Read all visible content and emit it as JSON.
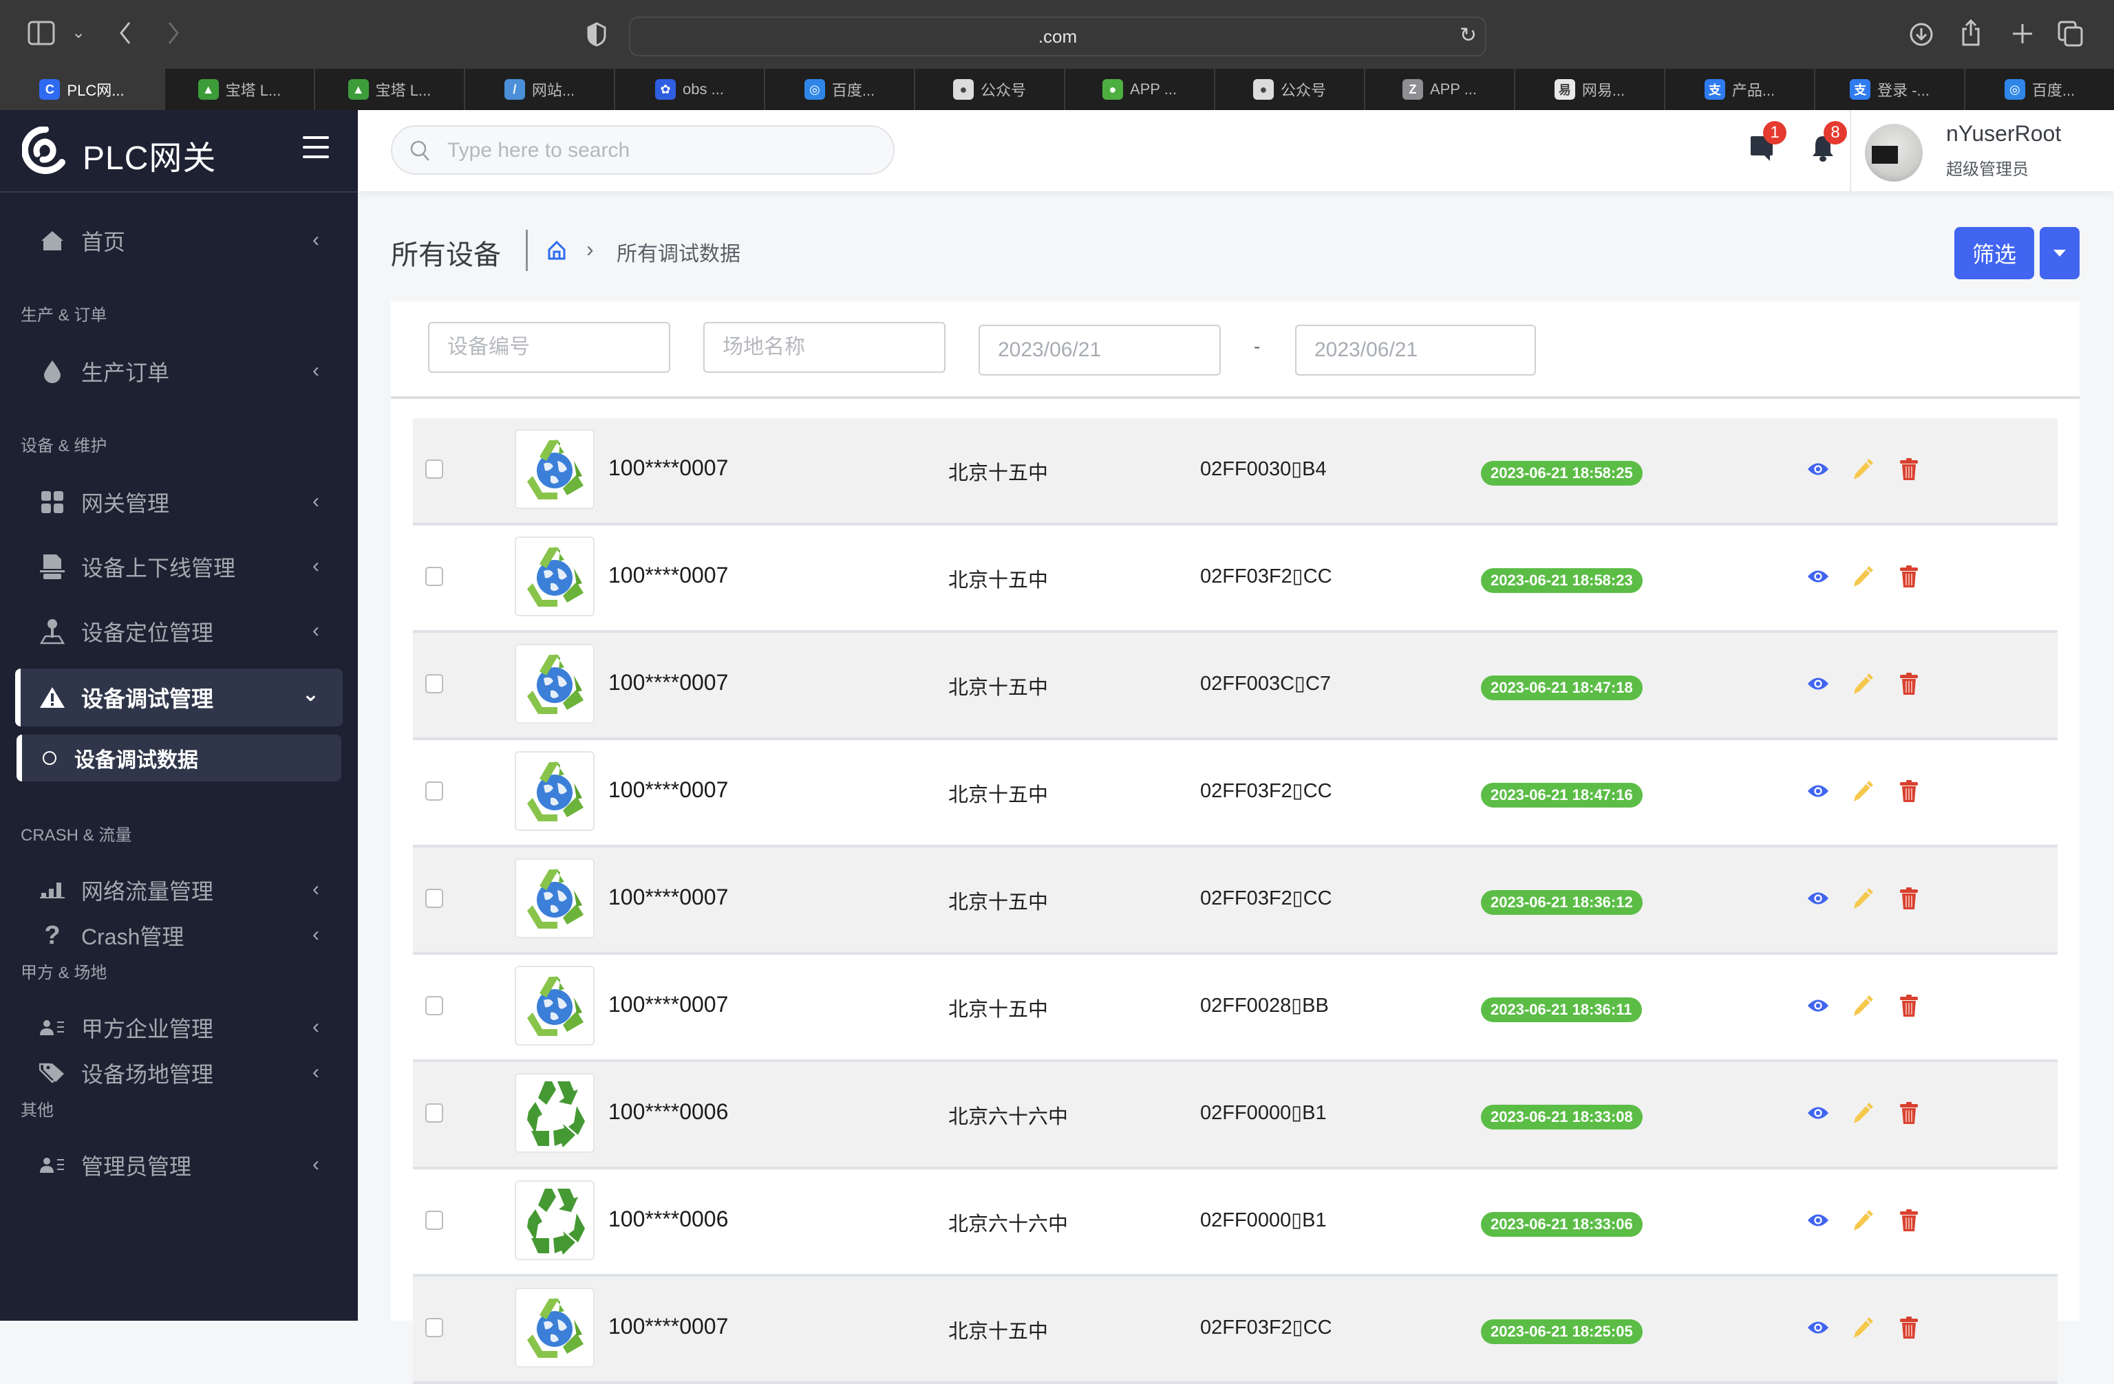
{
  "browser": {
    "url": ".com",
    "tabs": [
      {
        "label": "PLC网...",
        "icon": "plc-favicon",
        "color": "#2f6bf2",
        "glyph": "C"
      },
      {
        "label": "宝塔 L...",
        "icon": "baota-favicon",
        "color": "#3d9c3a",
        "glyph": "▲"
      },
      {
        "label": "宝塔 L...",
        "icon": "baota-favicon",
        "color": "#3d9c3a",
        "glyph": "▲"
      },
      {
        "label": "网站...",
        "icon": "website-favicon",
        "color": "#4a8fd8",
        "glyph": "/"
      },
      {
        "label": "obs ...",
        "icon": "baidu-paw-favicon",
        "color": "#2f5fe0",
        "glyph": "✿"
      },
      {
        "label": "百度...",
        "icon": "baidu-cloud-favicon",
        "color": "#2f86e8",
        "glyph": "◎"
      },
      {
        "label": "公众号",
        "icon": "wechat-official-favicon",
        "color": "#dcdcdc",
        "glyph": "●"
      },
      {
        "label": "APP ...",
        "icon": "wechat-favicon",
        "color": "#4caf3f",
        "glyph": "●"
      },
      {
        "label": "公众号",
        "icon": "wechat-official-favicon",
        "color": "#dcdcdc",
        "glyph": "●"
      },
      {
        "label": "APP ...",
        "icon": "z-favicon",
        "color": "#8e8e93",
        "glyph": "Z"
      },
      {
        "label": "网易...",
        "icon": "netease-favicon",
        "color": "#e8e8e8",
        "glyph": "易"
      },
      {
        "label": "产品...",
        "icon": "alipay-favicon",
        "color": "#2f7bf0",
        "glyph": "支"
      },
      {
        "label": "登录 -...",
        "icon": "alipay-favicon",
        "color": "#2f7bf0",
        "glyph": "支"
      },
      {
        "label": "百度...",
        "icon": "baidu-cloud-favicon",
        "color": "#2f86e8",
        "glyph": "◎"
      }
    ]
  },
  "sidebar": {
    "brand": "PLC网关",
    "sections": [
      {
        "title": "生产 & 订单"
      },
      {
        "title": "设备 & 维护"
      },
      {
        "title": "CRASH & 流量"
      },
      {
        "title": "甲方 & 场地"
      },
      {
        "title": "其他"
      }
    ],
    "items": [
      {
        "label": "首页",
        "icon": "home-icon"
      },
      {
        "label": "生产订单",
        "icon": "drop-icon"
      },
      {
        "label": "网关管理",
        "icon": "grid-icon"
      },
      {
        "label": "设备上下线管理",
        "icon": "file-stack-icon"
      },
      {
        "label": "设备定位管理",
        "icon": "location-pin-icon"
      },
      {
        "label": "设备调试管理",
        "icon": "warning-icon",
        "active": true
      },
      {
        "label": "网络流量管理",
        "icon": "bar-chart-icon"
      },
      {
        "label": "Crash管理",
        "icon": "question-icon"
      },
      {
        "label": "甲方企业管理",
        "icon": "user-list-icon"
      },
      {
        "label": "设备场地管理",
        "icon": "tags-icon"
      },
      {
        "label": "管理员管理",
        "icon": "user-list-icon"
      }
    ],
    "subitem": {
      "label": "设备调试数据"
    }
  },
  "header": {
    "search_placeholder": "Type here to search",
    "messages_count": "1",
    "notifications_count": "8",
    "user_name": "nYuserRoot",
    "user_role": "超级管理员"
  },
  "page": {
    "title": "所有设备",
    "breadcrumb_current": "所有调试数据",
    "filter_button": "筛选"
  },
  "filters": {
    "device_no_placeholder": "设备编号",
    "site_name_placeholder": "场地名称",
    "date_from": "2023/06/21",
    "date_to": "2023/06/21",
    "separator": "-"
  },
  "colors": {
    "primary": "#4165f0",
    "success": "#5bbd46",
    "warning": "#f5c84c",
    "danger": "#d9412f",
    "sidebar_bg": "#1e2132"
  },
  "rows": [
    {
      "code": "100****0007",
      "site": "北京十五中",
      "hex": "02FF0030▯B4",
      "time": "2023-06-21 18:58:25",
      "thumb": "globe"
    },
    {
      "code": "100****0007",
      "site": "北京十五中",
      "hex": "02FF03F2▯CC",
      "time": "2023-06-21 18:58:23",
      "thumb": "globe"
    },
    {
      "code": "100****0007",
      "site": "北京十五中",
      "hex": "02FF003C▯C7",
      "time": "2023-06-21 18:47:18",
      "thumb": "globe"
    },
    {
      "code": "100****0007",
      "site": "北京十五中",
      "hex": "02FF03F2▯CC",
      "time": "2023-06-21 18:47:16",
      "thumb": "globe"
    },
    {
      "code": "100****0007",
      "site": "北京十五中",
      "hex": "02FF03F2▯CC",
      "time": "2023-06-21 18:36:12",
      "thumb": "globe"
    },
    {
      "code": "100****0007",
      "site": "北京十五中",
      "hex": "02FF0028▯BB",
      "time": "2023-06-21 18:36:11",
      "thumb": "globe"
    },
    {
      "code": "100****0006",
      "site": "北京六十六中",
      "hex": "02FF0000▯B1",
      "time": "2023-06-21 18:33:08",
      "thumb": "recycle"
    },
    {
      "code": "100****0006",
      "site": "北京六十六中",
      "hex": "02FF0000▯B1",
      "time": "2023-06-21 18:33:06",
      "thumb": "recycle"
    },
    {
      "code": "100****0007",
      "site": "北京十五中",
      "hex": "02FF03F2▯CC",
      "time": "2023-06-21 18:25:05",
      "thumb": "globe"
    }
  ]
}
